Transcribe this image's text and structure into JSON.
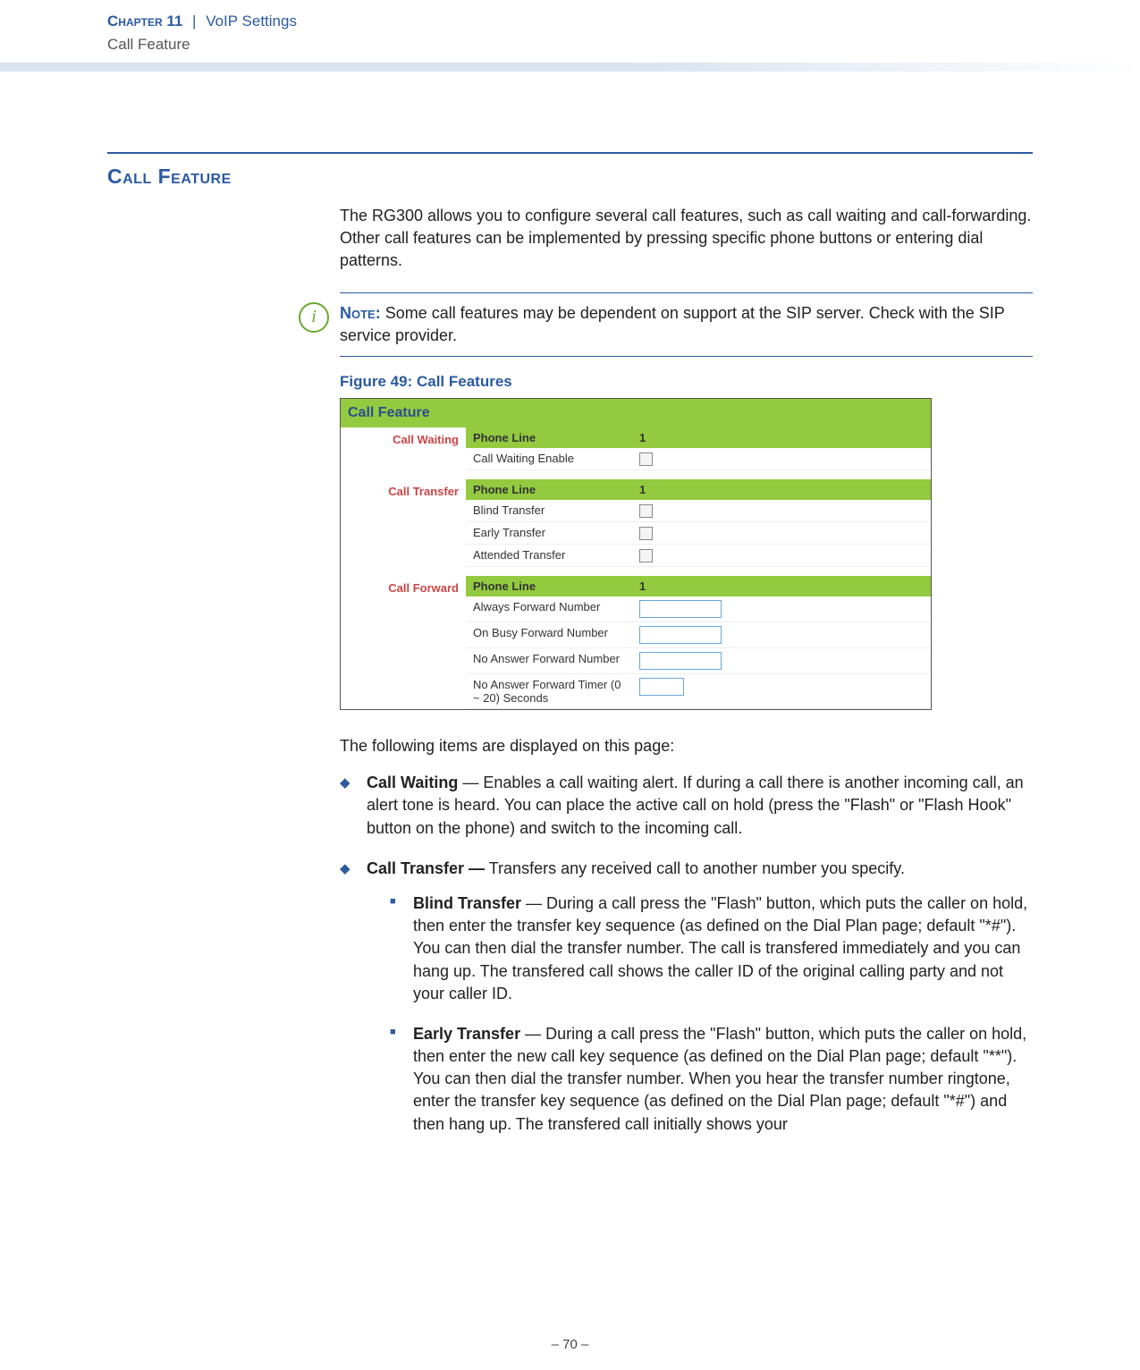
{
  "header": {
    "chapter_label": "Chapter 11",
    "pipe": "|",
    "title": "VoIP Settings",
    "subtitle": "Call Feature"
  },
  "section_title": "Call Feature",
  "intro": "The RG300 allows you to configure several call features, such as call waiting and call-forwarding. Other call features can be implemented by pressing specific phone buttons or entering dial patterns.",
  "note": {
    "icon": "i",
    "label": "Note:",
    "text": "Some call features may be dependent on support at the SIP server. Check with the SIP service provider."
  },
  "figure": {
    "caption": "Figure 49:  Call Features",
    "header": "Call Feature",
    "sections": {
      "call_waiting": {
        "side": "Call Waiting",
        "phone_line_label": "Phone Line",
        "phone_line_value": "1",
        "rows": [
          {
            "label": "Call Waiting Enable",
            "type": "checkbox"
          }
        ]
      },
      "call_transfer": {
        "side": "Call Transfer",
        "phone_line_label": "Phone Line",
        "phone_line_value": "1",
        "rows": [
          {
            "label": "Blind Transfer",
            "type": "checkbox"
          },
          {
            "label": "Early Transfer",
            "type": "checkbox"
          },
          {
            "label": "Attended Transfer",
            "type": "checkbox"
          }
        ]
      },
      "call_forward": {
        "side": "Call Forward",
        "phone_line_label": "Phone Line",
        "phone_line_value": "1",
        "rows": [
          {
            "label": "Always Forward Number",
            "type": "text"
          },
          {
            "label": "On Busy Forward Number",
            "type": "text"
          },
          {
            "label": "No Answer Forward Number",
            "type": "text"
          },
          {
            "label": "No Answer Forward Timer (0 ~ 20) Seconds",
            "type": "text-sm"
          }
        ]
      }
    }
  },
  "items_intro": "The following items are displayed on this page:",
  "items": {
    "call_waiting": {
      "title": "Call Waiting",
      "sep": " — ",
      "text": "Enables a call waiting alert. If during a call there is another incoming call, an alert tone is heard. You can place the active call on hold (press the \"Flash\" or \"Flash Hook\" button on the phone) and switch to the incoming call."
    },
    "call_transfer": {
      "title": "Call Transfer —",
      "text": " Transfers any received call to another number you specify.",
      "sub": {
        "blind": {
          "title": "Blind Transfer",
          "sep": " — ",
          "text": "During a call press the \"Flash\" button, which puts the caller on hold, then enter the transfer key sequence (as defined on the Dial Plan page; default \"*#\"). You can then dial the transfer number. The call is transfered immediately and you can hang up. The transfered call shows the caller ID of the original calling party and not your caller ID."
        },
        "early": {
          "title": "Early Transfer",
          "sep": " — ",
          "text": "During a call press the \"Flash\" button, which puts the caller on hold, then enter the new call key sequence (as defined on the Dial Plan page; default \"**\"). You can then dial the transfer number. When you hear the transfer number ringtone, enter the transfer key sequence (as defined on the Dial Plan page; default \"*#\") and then hang up. The transfered call initially shows your"
        }
      }
    }
  },
  "footer": "–  70  –"
}
